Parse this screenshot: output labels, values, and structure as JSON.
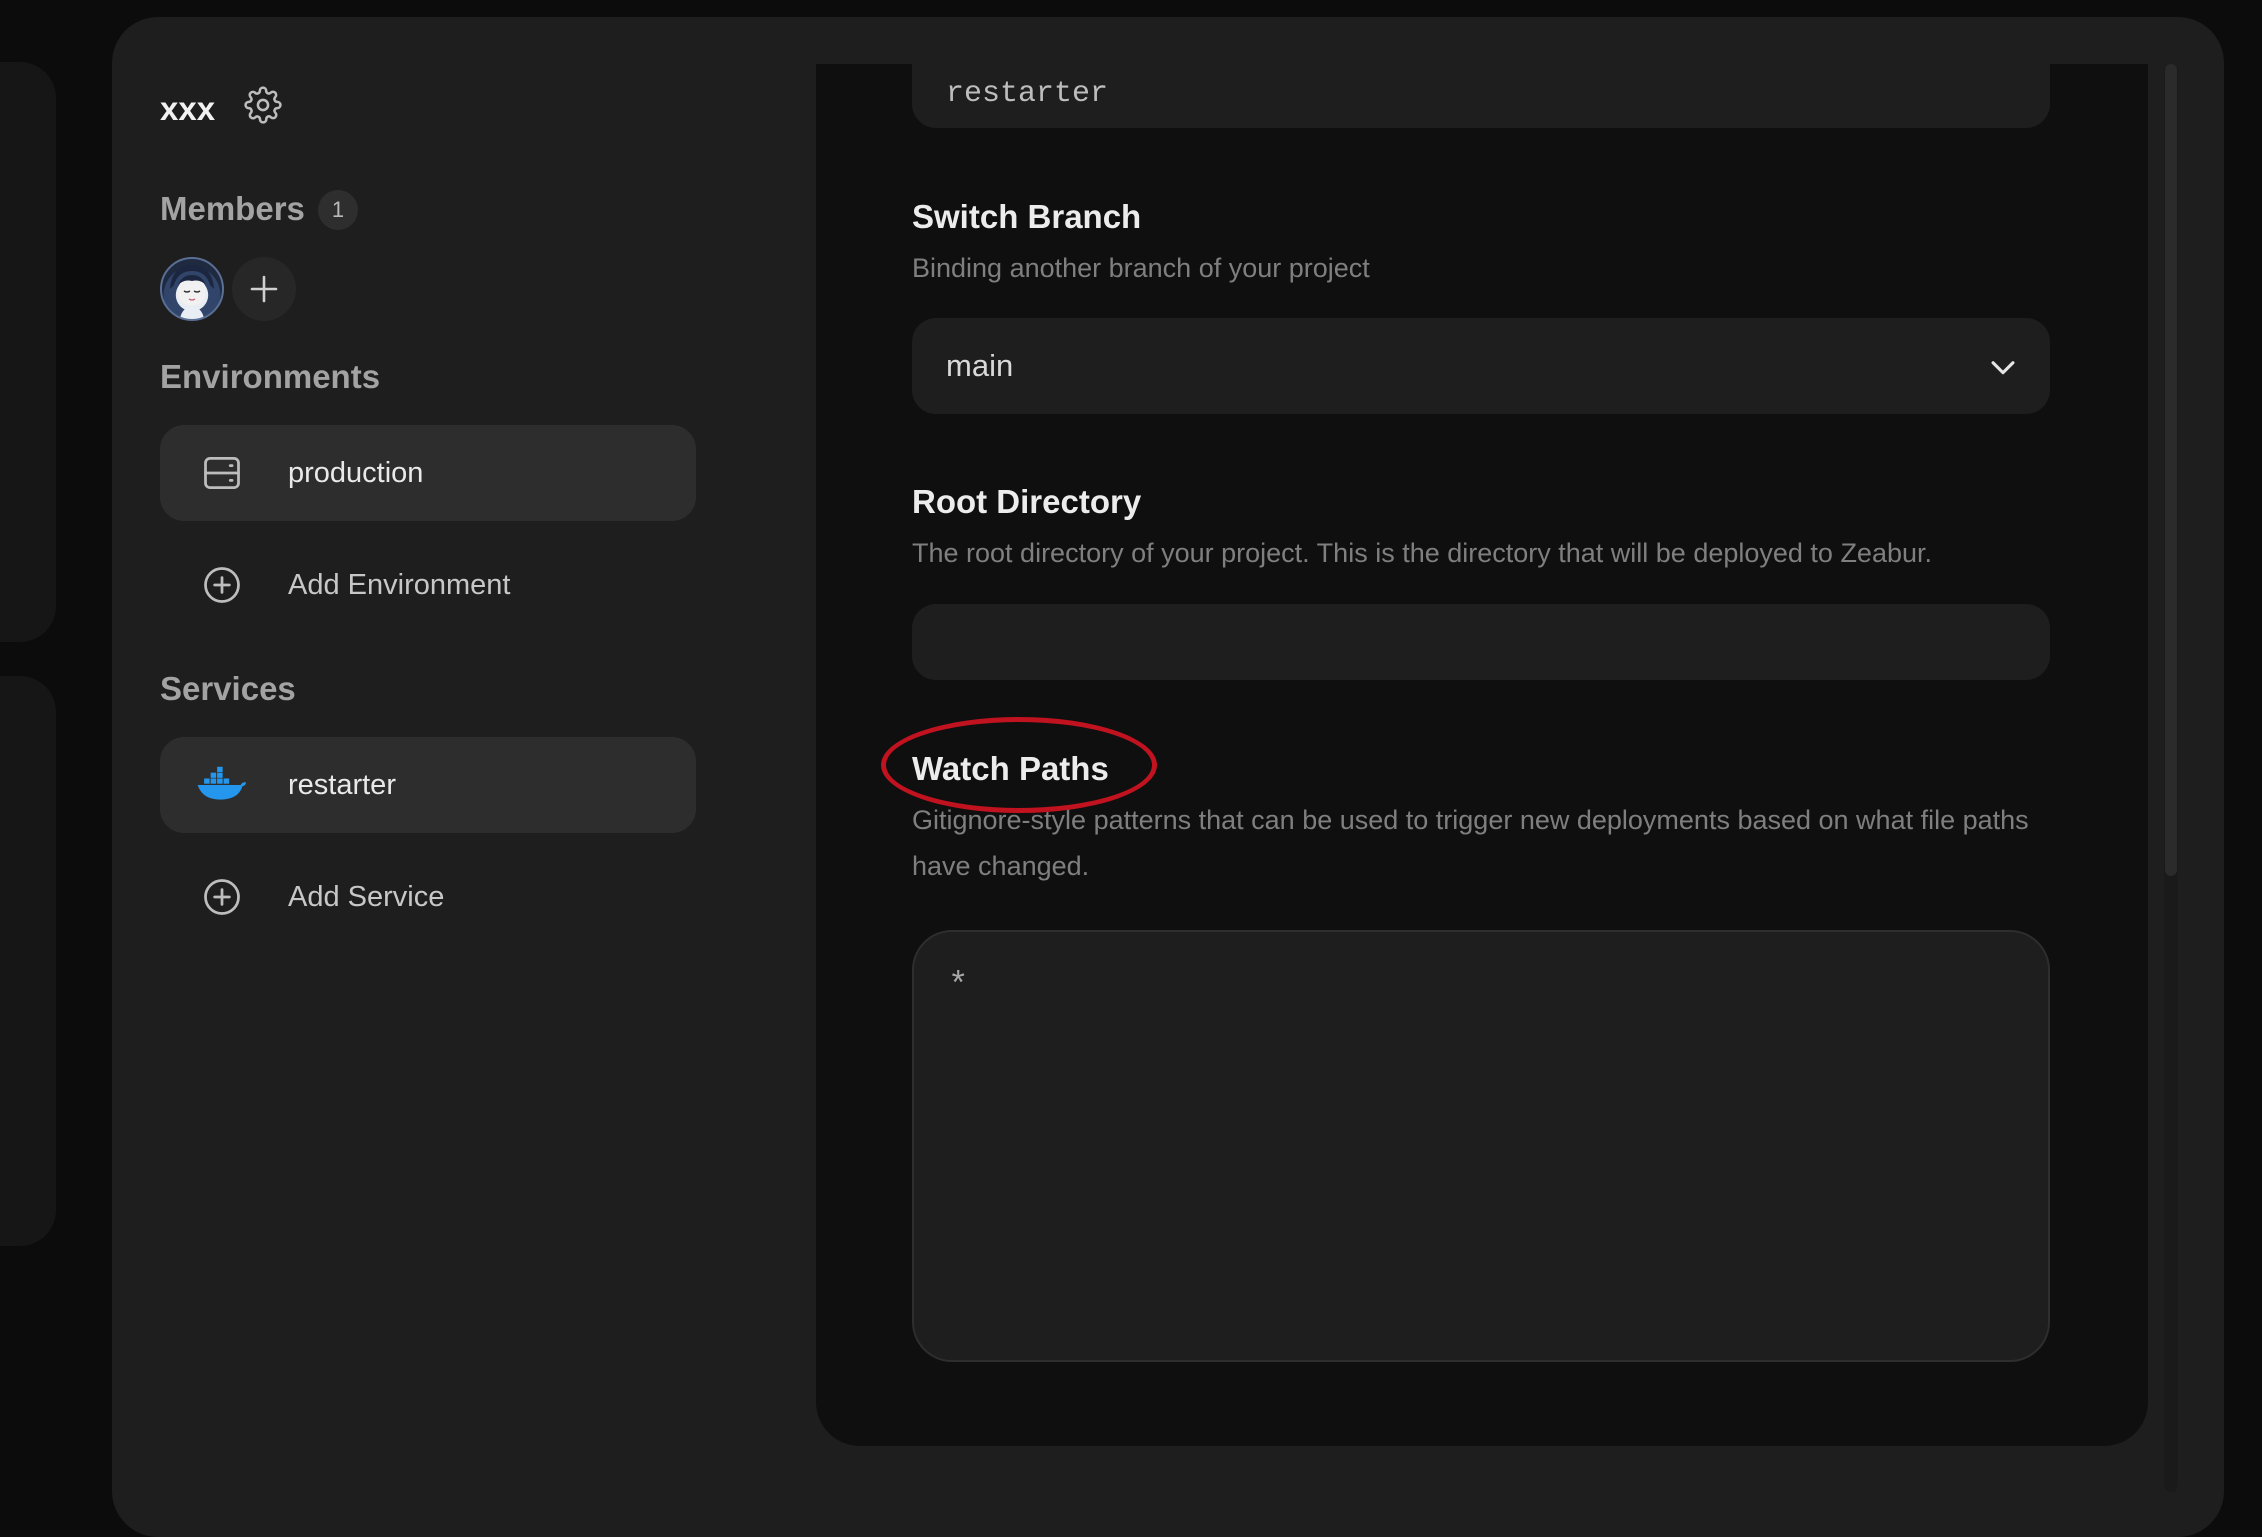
{
  "sidebar": {
    "project_name": "xxx",
    "members": {
      "title": "Members",
      "count": "1"
    },
    "environments": {
      "title": "Environments",
      "items": [
        {
          "label": "production",
          "icon": "server-icon",
          "active": true
        }
      ],
      "add_label": "Add Environment"
    },
    "services": {
      "title": "Services",
      "items": [
        {
          "label": "restarter",
          "icon": "docker-icon",
          "active": true
        }
      ],
      "add_label": "Add Service"
    }
  },
  "main": {
    "service_name_value": "restarter",
    "switch_branch": {
      "title": "Switch Branch",
      "description": "Binding another branch of your project",
      "selected": "main"
    },
    "root_directory": {
      "title": "Root Directory",
      "description": "The root directory of your project. This is the directory that will be deployed to Zeabur.",
      "value": ""
    },
    "watch_paths": {
      "title": "Watch Paths",
      "description": "Gitignore-style patterns that can be used to trigger new deployments based on what file paths have changed.",
      "value": "*"
    }
  },
  "colors": {
    "annotation_ring": "#c1121f",
    "docker_blue": "#2496ed"
  }
}
